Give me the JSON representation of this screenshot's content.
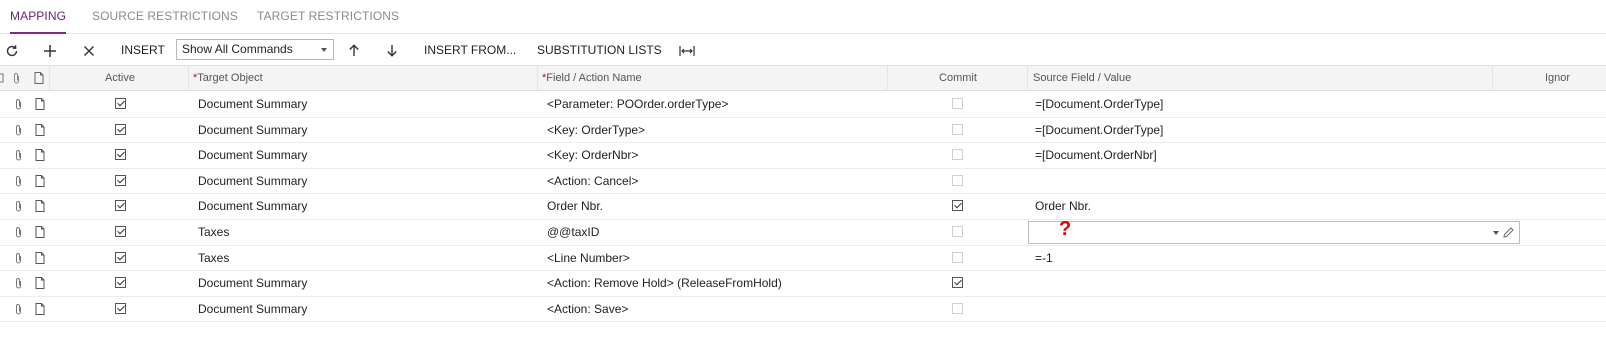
{
  "tabs": [
    {
      "label": "MAPPING",
      "active": true
    },
    {
      "label": "SOURCE RESTRICTIONS",
      "active": false
    },
    {
      "label": "TARGET RESTRICTIONS",
      "active": false
    }
  ],
  "toolbar": {
    "refresh_icon": "refresh-icon",
    "add_icon": "plus-icon",
    "delete_icon": "close-icon",
    "insert_label": "INSERT",
    "command_filter_value": "Show All Commands",
    "move_up_icon": "arrow-up-icon",
    "move_down_icon": "arrow-down-icon",
    "insert_from_label": "INSERT FROM...",
    "substitution_lists_label": "SUBSTITUTION LISTS",
    "fit_columns_icon": "fit-columns-icon"
  },
  "grid": {
    "columns": {
      "active": "Active",
      "target_object": "Target Object",
      "field_action_name": "Field / Action Name",
      "commit": "Commit",
      "source_field_value": "Source Field / Value",
      "ignore": "Ignor"
    },
    "rows": [
      {
        "active": true,
        "target_object": "Document Summary",
        "field": "<Parameter: POOrder.orderType>",
        "commit": false,
        "source": "=[Document.OrderType]"
      },
      {
        "active": true,
        "target_object": "Document Summary",
        "field": "<Key: OrderType>",
        "commit": false,
        "source": "=[Document.OrderType]"
      },
      {
        "active": true,
        "target_object": "Document Summary",
        "field": "<Key: OrderNbr>",
        "commit": false,
        "source": "=[Document.OrderNbr]"
      },
      {
        "active": true,
        "target_object": "Document Summary",
        "field": "<Action: Cancel>",
        "commit": false,
        "source": ""
      },
      {
        "active": true,
        "target_object": "Document Summary",
        "field": "Order Nbr.",
        "commit": true,
        "source": "Order Nbr."
      },
      {
        "active": true,
        "target_object": "Taxes",
        "field": "@@taxID",
        "commit": false,
        "source": "",
        "editing": true,
        "annotation": "?"
      },
      {
        "active": true,
        "target_object": "Taxes",
        "field": "<Line Number>",
        "commit": false,
        "source": "=-1"
      },
      {
        "active": true,
        "target_object": "Document Summary",
        "field": "<Action: Remove Hold> (ReleaseFromHold)",
        "commit": true,
        "source": ""
      },
      {
        "active": true,
        "target_object": "Document Summary",
        "field": "<Action: Save>",
        "commit": false,
        "source": ""
      }
    ]
  },
  "colors": {
    "accent": "#7a2a8c",
    "annotation": "#e00000"
  }
}
